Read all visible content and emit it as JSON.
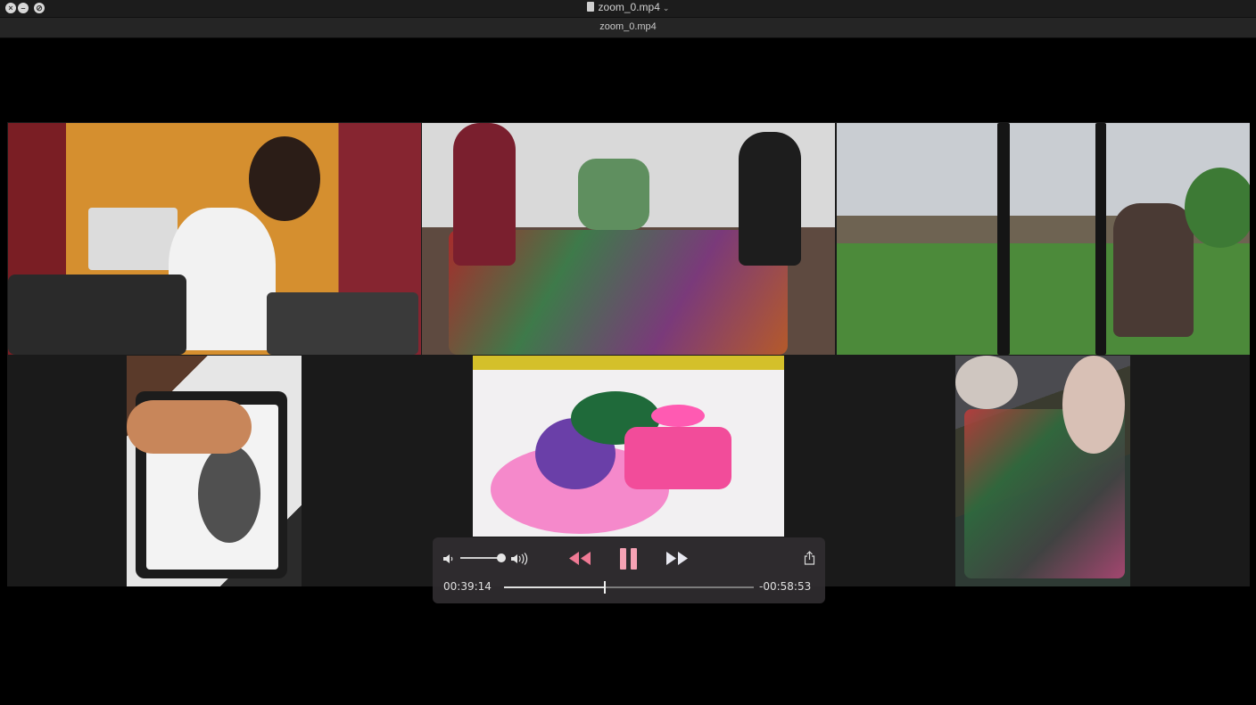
{
  "window": {
    "title": "zoom_0.mp4",
    "tab_title": "zoom_0.mp4",
    "traffic_lights": [
      "close-icon",
      "minimize-icon",
      "fullscreen-icon"
    ]
  },
  "video": {
    "layout": "gallery",
    "tiles": 6
  },
  "player": {
    "elapsed": "00:39:14",
    "remaining": "-00:58:53",
    "progress": 0.4,
    "volume": 0.9,
    "state": "playing",
    "icons": [
      "volume-low-icon",
      "volume-high-icon",
      "rewind-icon",
      "pause-icon",
      "fast-forward-icon",
      "share-icon"
    ]
  }
}
